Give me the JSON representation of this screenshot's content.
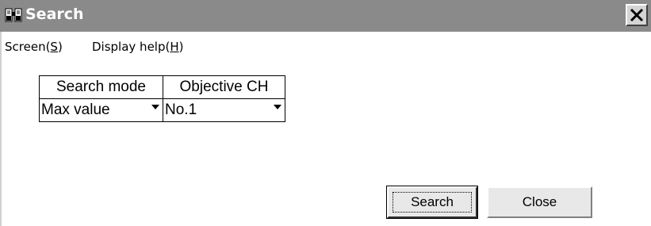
{
  "window": {
    "title": "Search",
    "title_icon": "binoculars-icon",
    "close_icon": "close-icon"
  },
  "menu": [
    {
      "label_prefix": "Screen(",
      "mnemonic": "S",
      "label_suffix": ")"
    },
    {
      "label_prefix": "Display help(",
      "mnemonic": "H",
      "label_suffix": ")"
    }
  ],
  "grid": {
    "headers": [
      "Search mode",
      "Objective CH"
    ],
    "values": [
      "Max value",
      "No.1"
    ]
  },
  "buttons": {
    "search": "Search",
    "close": "Close"
  },
  "colors": {
    "titlebar": "#8a8a8a",
    "background": "#ffffff"
  }
}
